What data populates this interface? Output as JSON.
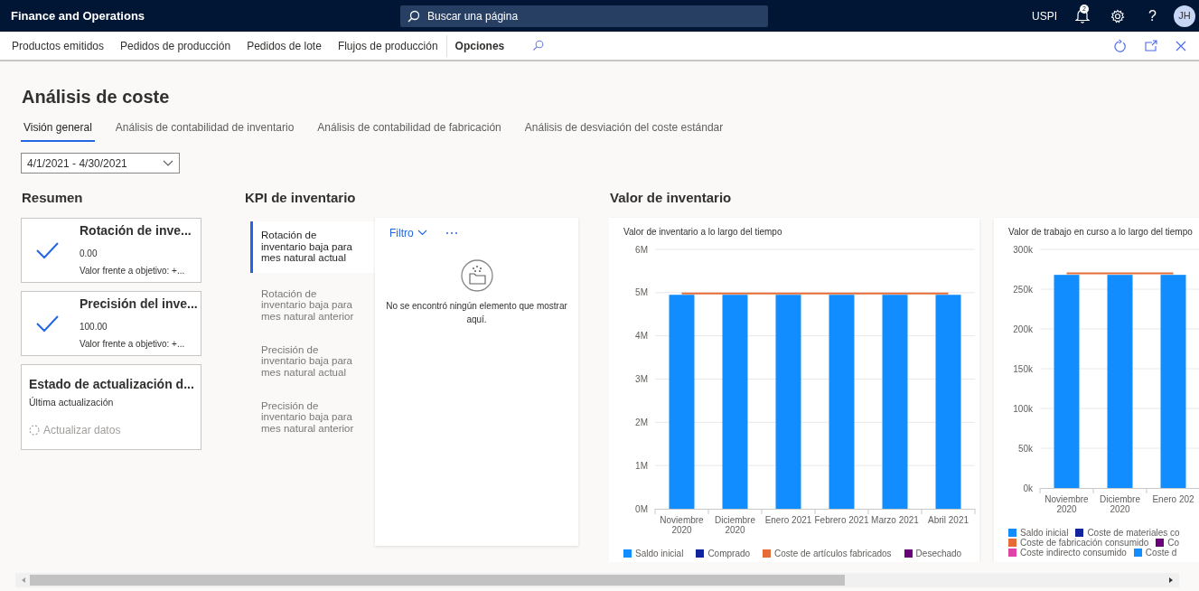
{
  "app": {
    "title": "Finance and Operations",
    "search_placeholder": "Buscar una página",
    "company": "USPI",
    "notifications_count": "2",
    "help": "?",
    "avatar_initials": "JH"
  },
  "command_bar": {
    "items": [
      "Productos emitidos",
      "Pedidos de producción",
      "Pedidos de lote",
      "Flujos de producción"
    ],
    "options": "Opciones"
  },
  "page": {
    "title": "Análisis de coste",
    "date_range": "4/1/2021 - 4/30/2021",
    "tabs": [
      {
        "label": "Visión general",
        "selected": true
      },
      {
        "label": "Análisis de contabilidad de inventario",
        "selected": false
      },
      {
        "label": "Análisis de contabilidad de fabricación",
        "selected": false
      },
      {
        "label": "Análisis de desviación del coste estándar",
        "selected": false
      }
    ]
  },
  "summary": {
    "heading": "Resumen",
    "tiles": [
      {
        "kind": "kpi",
        "title": "Rotación de inve...",
        "value": "0.00",
        "subtitle": "Valor frente a objetivo: +..."
      },
      {
        "kind": "kpi",
        "title": "Precisión del inve...",
        "value": "100.00",
        "subtitle": "Valor frente a objetivo: +..."
      },
      {
        "kind": "status",
        "title": "Estado de actualización d...",
        "subtitle": "Última actualización",
        "action": "Actualizar datos",
        "action_disabled": true
      }
    ]
  },
  "kpi": {
    "heading": "KPI de inventario",
    "items": [
      {
        "label": "Rotación de inventario baja para mes natural actual",
        "selected": true
      },
      {
        "label": "Rotación de inventario baja para mes natural anterior",
        "selected": false
      },
      {
        "label": "Precisión de inventario baja para mes natural actual",
        "selected": false
      },
      {
        "label": "Precisión de inventario baja para mes natural anterior",
        "selected": false
      }
    ],
    "filter": "Filtro",
    "empty_message": "No se encontró ningún elemento que mostrar aquí."
  },
  "inventory_value": {
    "heading": "Valor de inventario",
    "charts": [
      {
        "chart_data": {
          "type": "bar",
          "grid": true,
          "title": "Valor de inventario a lo largo del tiempo",
          "categories": [
            "Noviembre 2020",
            "Diciembre 2020",
            "Enero 2021",
            "Febrero 2021",
            "Marzo 2021",
            "Abril 2021"
          ],
          "ylim": [
            0,
            6000000
          ],
          "yticks": [
            {
              "value": 0,
              "label": "0M"
            },
            {
              "value": 1000000,
              "label": "1M"
            },
            {
              "value": 2000000,
              "label": "2M"
            },
            {
              "value": 3000000,
              "label": "3M"
            },
            {
              "value": 4000000,
              "label": "4M"
            },
            {
              "value": 5000000,
              "label": "5M"
            },
            {
              "value": 6000000,
              "label": "6M"
            }
          ],
          "series": [
            {
              "color": "#118dff",
              "type": "bar",
              "values": [
                4950000,
                4950000,
                4950000,
                4950000,
                4950000,
                4950000
              ]
            },
            {
              "color": "#e66c37",
              "type": "line",
              "values": [
                4980000,
                4980000,
                4980000,
                4980000,
                4980000,
                4980000
              ]
            }
          ]
        },
        "legend": [
          {
            "label": "Saldo inicial",
            "color": "#118dff"
          },
          {
            "label": "Comprado",
            "color": "#12239e"
          },
          {
            "label": "Coste de artículos fabricados",
            "color": "#e66c37"
          },
          {
            "label": "Desechado",
            "color": "#6b007b"
          }
        ]
      },
      {
        "chart_data": {
          "type": "bar",
          "grid": true,
          "title": "Valor de trabajo en curso a lo largo del tiempo",
          "categories": [
            "Noviembre 2020",
            "Diciembre 2020",
            "Enero 202"
          ],
          "ylim": [
            0,
            300000
          ],
          "yticks": [
            {
              "value": 0,
              "label": "0k"
            },
            {
              "value": 50000,
              "label": "50k"
            },
            {
              "value": 100000,
              "label": "100k"
            },
            {
              "value": 150000,
              "label": "150k"
            },
            {
              "value": 200000,
              "label": "200k"
            },
            {
              "value": 250000,
              "label": "250k"
            },
            {
              "value": 300000,
              "label": "300k"
            }
          ],
          "series": [
            {
              "color": "#118dff",
              "type": "bar",
              "values": [
                268000,
                268000,
                268000
              ]
            },
            {
              "color": "#e66c37",
              "type": "line",
              "values": [
                270000,
                270000,
                270000
              ]
            }
          ]
        },
        "legend": [
          {
            "label": "Saldo inicial",
            "color": "#118dff"
          },
          {
            "label": "Coste de materiales co",
            "color": "#12239e"
          },
          {
            "label": "Coste de fabricación consumido",
            "color": "#e66c37"
          },
          {
            "label": "Co",
            "color": "#6b007b"
          },
          {
            "label": "Coste indirecto consumido",
            "color": "#e044a7"
          },
          {
            "label": "Coste d",
            "color": "#118dff"
          }
        ]
      }
    ]
  }
}
